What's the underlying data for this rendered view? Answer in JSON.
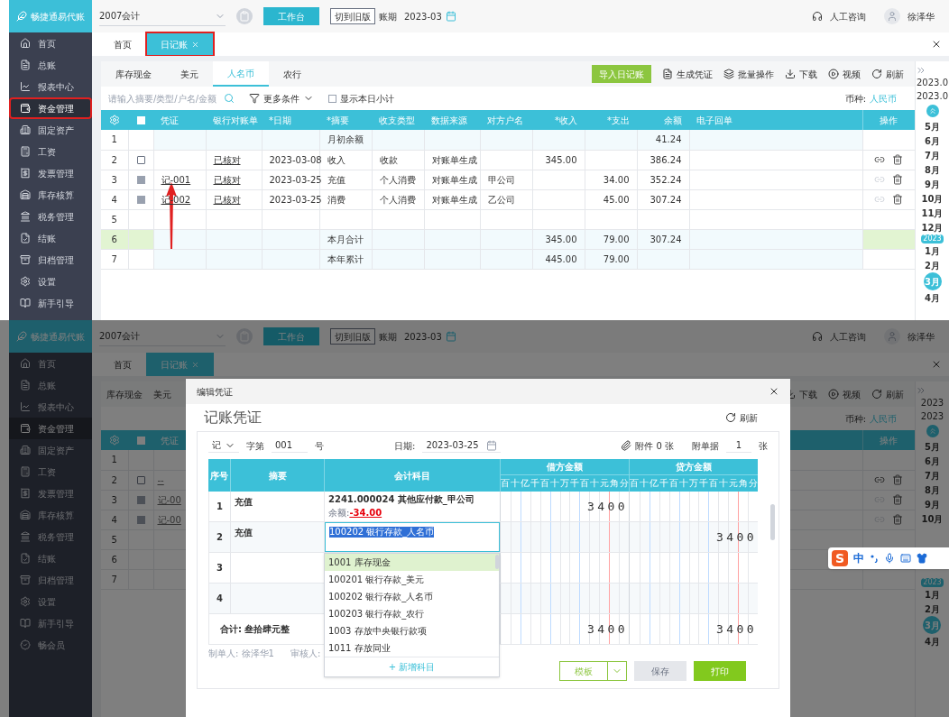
{
  "top": {
    "brand": "畅捷通易代账",
    "header": {
      "account": "2007会计",
      "workbench": "工作台",
      "switch_version": "切到旧版",
      "period_label": "账期",
      "period": "2023-03",
      "support": "人工咨询",
      "user": "徐泽华"
    },
    "sidebar": [
      {
        "label": "首页",
        "selected": false,
        "highlighted": false
      },
      {
        "label": "总账",
        "selected": false,
        "highlighted": false
      },
      {
        "label": "报表中心",
        "selected": false,
        "highlighted": false
      },
      {
        "label": "资金管理",
        "selected": true,
        "highlighted": true
      },
      {
        "label": "固定资产",
        "selected": false,
        "highlighted": false
      },
      {
        "label": "工资",
        "selected": false,
        "highlighted": false
      },
      {
        "label": "发票管理",
        "selected": false,
        "highlighted": false
      },
      {
        "label": "库存核算",
        "selected": false,
        "highlighted": false
      },
      {
        "label": "税务管理",
        "selected": false,
        "highlighted": false
      },
      {
        "label": "结账",
        "selected": false,
        "highlighted": false
      },
      {
        "label": "归档管理",
        "selected": false,
        "highlighted": false
      },
      {
        "label": "设置",
        "selected": false,
        "highlighted": false
      },
      {
        "label": "新手引导",
        "selected": false,
        "highlighted": false
      }
    ],
    "tabs": [
      {
        "label": "首页",
        "selected": false,
        "closable": false,
        "highlighted": false
      },
      {
        "label": "日记账",
        "selected": true,
        "closable": true,
        "highlighted": true
      }
    ],
    "account_tabs": [
      {
        "label": "库存现金",
        "selected": false
      },
      {
        "label": "美元",
        "selected": false
      },
      {
        "label": "人名币",
        "selected": true
      },
      {
        "label": "农行",
        "selected": false
      }
    ],
    "toolbar": [
      {
        "label": "导入日记账",
        "kind": "primary"
      },
      {
        "label": "生成凭证",
        "kind": "voucher"
      },
      {
        "label": "批量操作",
        "kind": "batch"
      },
      {
        "label": "下载",
        "kind": "download"
      },
      {
        "label": "视频",
        "kind": "video"
      },
      {
        "label": "刷新",
        "kind": "refresh"
      }
    ],
    "search": {
      "placeholder": "请输入摘要/类型/户名/金额"
    },
    "more_filters": "更多条件",
    "daily_subtotal": {
      "label": "显示本日小计",
      "checked": false
    },
    "currency": {
      "label": "币种:",
      "value": "人民币"
    },
    "table": {
      "columns": [
        {
          "kind": "settings"
        },
        {
          "kind": "select"
        },
        {
          "label": "凭证",
          "kind": "link"
        },
        {
          "label": "银行对账单",
          "kind": "link"
        },
        {
          "label": "*日期",
          "kind": "text"
        },
        {
          "label": "*摘要",
          "kind": "text"
        },
        {
          "label": "收支类型",
          "kind": "text"
        },
        {
          "label": "数据来源",
          "kind": "text"
        },
        {
          "label": "对方户名",
          "kind": "text"
        },
        {
          "label": "*收入",
          "kind": "amount"
        },
        {
          "label": "*支出",
          "kind": "amount"
        },
        {
          "label": "余额",
          "kind": "amount"
        },
        {
          "label": "电子回单",
          "kind": "text"
        },
        {
          "label": "操作",
          "kind": "actions"
        }
      ],
      "all_selected": false,
      "rows": [
        {
          "no": "1",
          "kind": "opening",
          "checkbox": false,
          "summary": "月初余额",
          "balance": "41.24",
          "actions": false
        },
        {
          "no": "2",
          "kind": "entry",
          "checkbox": true,
          "disabled": false,
          "statement": "已核对",
          "date": "2023-03-08",
          "summary": "收入",
          "type": "收款",
          "source": "对账单生成",
          "income": "345.00",
          "balance": "386.24",
          "actions": true,
          "link_enabled": true
        },
        {
          "no": "3",
          "kind": "entry",
          "checkbox": true,
          "disabled": true,
          "voucher": "记-001",
          "statement": "已核对",
          "date": "2023-03-25",
          "summary": "充值",
          "type": "个人消费",
          "source": "对账单生成",
          "party": "甲公司",
          "expense": "34.00",
          "balance": "352.24",
          "actions": true,
          "link_enabled": false
        },
        {
          "no": "4",
          "kind": "entry",
          "checkbox": true,
          "disabled": true,
          "voucher": "记-002",
          "statement": "已核对",
          "date": "2023-03-25",
          "summary": "消费",
          "type": "个人消费",
          "source": "对账单生成",
          "party": "乙公司",
          "expense": "45.00",
          "balance": "307.24",
          "actions": true,
          "link_enabled": false
        },
        {
          "no": "5",
          "kind": "entry",
          "checkbox": false,
          "actions": false
        },
        {
          "no": "6",
          "kind": "month_total",
          "checkbox": false,
          "summary": "本月合计",
          "income": "345.00",
          "expense": "79.00",
          "balance": "307.24",
          "actions": false
        },
        {
          "no": "7",
          "kind": "year_total",
          "checkbox": false,
          "summary": "本年累计",
          "income": "445.00",
          "expense": "79.00",
          "actions": false
        }
      ]
    },
    "period_panel": {
      "ranges": [
        "2023.0",
        "2023.0"
      ],
      "items": [
        {
          "kind": "month",
          "label": "5月",
          "selected": false
        },
        {
          "kind": "month",
          "label": "6月",
          "selected": false
        },
        {
          "kind": "month",
          "label": "7月",
          "selected": false
        },
        {
          "kind": "month",
          "label": "8月",
          "selected": false
        },
        {
          "kind": "month",
          "label": "9月",
          "selected": false
        },
        {
          "kind": "month",
          "label": "10月",
          "selected": false
        },
        {
          "kind": "month",
          "label": "11月",
          "selected": false
        },
        {
          "kind": "month",
          "label": "12月",
          "selected": false
        },
        {
          "kind": "year",
          "label": "2023"
        },
        {
          "kind": "month",
          "label": "1月",
          "selected": false
        },
        {
          "kind": "month",
          "label": "2月",
          "selected": false
        },
        {
          "kind": "month",
          "label": "3月",
          "selected": true
        },
        {
          "kind": "month",
          "label": "4月",
          "selected": false
        }
      ]
    }
  },
  "bottom": {
    "brand": "畅捷通易代账",
    "header": {
      "account": "2007会计",
      "workbench": "工作台",
      "switch_version": "切到旧版",
      "period_label": "账期",
      "period": "2023-03",
      "support": "人工咨询",
      "user": "徐泽华"
    },
    "sidebar": [
      {
        "label": "首页",
        "selected": false,
        "highlighted": false
      },
      {
        "label": "总账",
        "selected": false,
        "highlighted": false
      },
      {
        "label": "报表中心",
        "selected": false,
        "highlighted": false
      },
      {
        "label": "资金管理",
        "selected": true,
        "highlighted": false
      },
      {
        "label": "固定资产",
        "selected": false,
        "highlighted": false
      },
      {
        "label": "工资",
        "selected": false,
        "highlighted": false
      },
      {
        "label": "发票管理",
        "selected": false,
        "highlighted": false
      },
      {
        "label": "库存核算",
        "selected": false,
        "highlighted": false
      },
      {
        "label": "税务管理",
        "selected": false,
        "highlighted": false
      },
      {
        "label": "结账",
        "selected": false,
        "highlighted": false
      },
      {
        "label": "归档管理",
        "selected": false,
        "highlighted": false
      },
      {
        "label": "设置",
        "selected": false,
        "highlighted": false
      },
      {
        "label": "新手引导",
        "selected": false,
        "highlighted": false
      },
      {
        "label": "畅会员",
        "selected": false,
        "highlighted": false
      }
    ],
    "tabs": [
      {
        "label": "首页",
        "selected": false,
        "closable": false,
        "highlighted": false
      },
      {
        "label": "日记账",
        "selected": true,
        "closable": true,
        "highlighted": false
      }
    ],
    "account_tabs": [
      {
        "label": "库存现金",
        "selected": false
      },
      {
        "label": "美元",
        "selected": false
      }
    ],
    "toolbar": [
      {
        "label": "下载",
        "kind": "download"
      },
      {
        "label": "视频",
        "kind": "video"
      },
      {
        "label": "刷新",
        "kind": "refresh"
      }
    ],
    "currency": {
      "label": "币种:",
      "value": "人民币"
    },
    "table": {
      "columns": [
        {
          "kind": "settings"
        },
        {
          "kind": "select"
        },
        {
          "label": "凭证",
          "kind": "link"
        },
        {
          "label": "操作",
          "kind": "actions"
        }
      ],
      "all_selected": false,
      "rows": [
        {
          "no": "1",
          "checkbox": false
        },
        {
          "no": "2",
          "checkbox": true,
          "disabled": false,
          "voucher": "--",
          "actions": true,
          "link_enabled": true
        },
        {
          "no": "3",
          "checkbox": true,
          "disabled": true,
          "voucher": "记-00",
          "actions": true,
          "link_enabled": false
        },
        {
          "no": "4",
          "checkbox": true,
          "disabled": true,
          "voucher": "记-00",
          "actions": true,
          "link_enabled": false
        },
        {
          "no": "5",
          "checkbox": false
        },
        {
          "no": "6",
          "checkbox": false
        },
        {
          "no": "7",
          "checkbox": false
        }
      ]
    },
    "period_panel": {
      "ranges": [
        "2023",
        "2023"
      ],
      "items": [
        {
          "kind": "month",
          "label": "5月",
          "selected": false
        },
        {
          "kind": "month",
          "label": "6月",
          "selected": false
        },
        {
          "kind": "month",
          "label": "7月",
          "selected": false
        },
        {
          "kind": "month",
          "label": "8月",
          "selected": false
        },
        {
          "kind": "month",
          "label": "9月",
          "selected": false
        },
        {
          "kind": "month",
          "label": "10月",
          "selected": false
        }
      ],
      "lower_items": [
        {
          "kind": "year",
          "label": "2023"
        },
        {
          "kind": "month",
          "label": "1月",
          "selected": false
        },
        {
          "kind": "month",
          "label": "2月",
          "selected": false
        },
        {
          "kind": "month",
          "label": "3月",
          "selected": true
        },
        {
          "kind": "month",
          "label": "4月",
          "selected": false
        }
      ]
    },
    "modal": {
      "title": "编辑凭证",
      "heading": "记账凭证",
      "refresh": "刷新",
      "voucher_type": "记",
      "number_label": "字第",
      "number": "001",
      "number_suffix": "号",
      "date_label": "日期:",
      "date": "2023-03-25",
      "attachments": "附件 0 张",
      "docs_label": "附单据",
      "docs": "1",
      "docs_suffix": "张",
      "columns": {
        "no": "序号",
        "summary": "摘要",
        "account": "会计科目",
        "debit": "借方金额",
        "credit": "贷方金额"
      },
      "debit_units": [
        "百",
        "十",
        "亿",
        "千",
        "百",
        "十",
        "万",
        "千",
        "百",
        "十",
        "元",
        "角",
        "分"
      ],
      "credit_units": [
        "百",
        "十",
        "亿",
        "千",
        "百",
        "十",
        "万",
        "千",
        "百",
        "十",
        "元",
        "角",
        "分"
      ],
      "lines": [
        {
          "no": "1",
          "summary": "充值",
          "account": "2241.000024 其他应付款_甲公司",
          "balance_label": "余额:",
          "balance": "-34.00",
          "debit": "3400",
          "editing": false
        },
        {
          "no": "2",
          "summary": "充值",
          "account": "100202 银行存款_人名币",
          "credit": "3400",
          "editing": true
        },
        {
          "no": "3"
        },
        {
          "no": "4"
        }
      ],
      "total": {
        "label": "合计: 叁拾肆元整",
        "debit": "3400",
        "credit": "3400"
      },
      "maker": "制单人: 徐泽华1",
      "reviewer": "审核人:",
      "suggestions": [
        {
          "label": "1001 库存现金",
          "selected": true
        },
        {
          "label": "100201 银行存款_美元",
          "selected": false
        },
        {
          "label": "100202 银行存款_人名币",
          "selected": false
        },
        {
          "label": "100203 银行存款_农行",
          "selected": false
        },
        {
          "label": "1003 存放中央银行款项",
          "selected": false
        },
        {
          "label": "1011 存放同业",
          "selected": false
        }
      ],
      "add_account": "+ 新增科目",
      "buttons": [
        {
          "label": "模板",
          "kind": "template",
          "disabled": false
        },
        {
          "label": "保存",
          "kind": "save",
          "disabled": true
        },
        {
          "label": "打印",
          "kind": "print",
          "disabled": false
        }
      ]
    },
    "ime": {
      "logo": "S",
      "mode": "中"
    }
  }
}
